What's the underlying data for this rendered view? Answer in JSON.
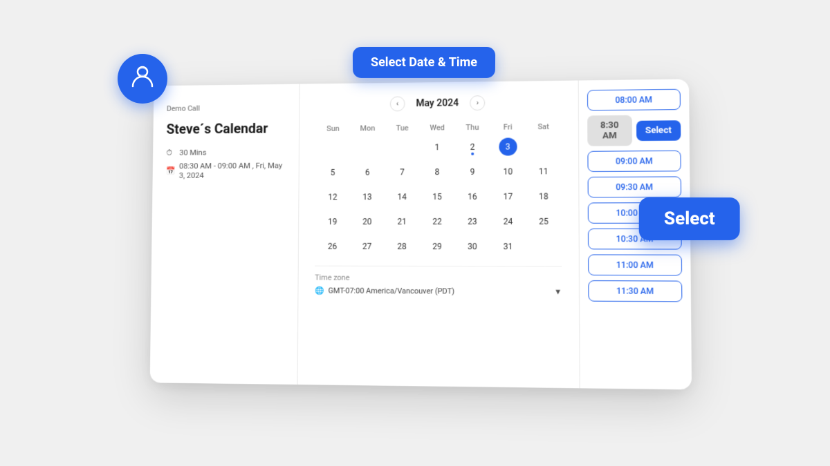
{
  "page": {
    "title": "Select Date & Time",
    "select_button": "Select"
  },
  "sidebar": {
    "label": "Demo Call",
    "name": "Steve´s Calendar",
    "duration": "30 Mins",
    "time": "08:30 AM - 09:00 AM , Fri, May 3, 2024"
  },
  "calendar": {
    "month": "May 2024",
    "weekdays": [
      "Sun",
      "Mon",
      "Tue",
      "Wed",
      "Thu",
      "Fri",
      "Sat"
    ],
    "weeks": [
      [
        "",
        "",
        "",
        "1",
        "2",
        "3",
        ""
      ],
      [
        "5",
        "6",
        "7",
        "8",
        "9",
        "10",
        "11"
      ],
      [
        "12",
        "13",
        "14",
        "15",
        "16",
        "17",
        "18"
      ],
      [
        "19",
        "20",
        "21",
        "22",
        "23",
        "24",
        "25"
      ],
      [
        "26",
        "27",
        "28",
        "29",
        "30",
        "31",
        ""
      ]
    ],
    "selected_day": "3",
    "dot_day": "2"
  },
  "timezone": {
    "label": "Time zone",
    "value": "GMT-07:00 America/Vancouver (PDT)"
  },
  "time_slots": [
    "08:00 AM",
    "8:30 AM",
    "09:00 AM",
    "09:30 AM",
    "10:00 AM",
    "10:30 AM",
    "11:00 AM",
    "11:30 AM"
  ],
  "selected_time": "8:30 AM"
}
